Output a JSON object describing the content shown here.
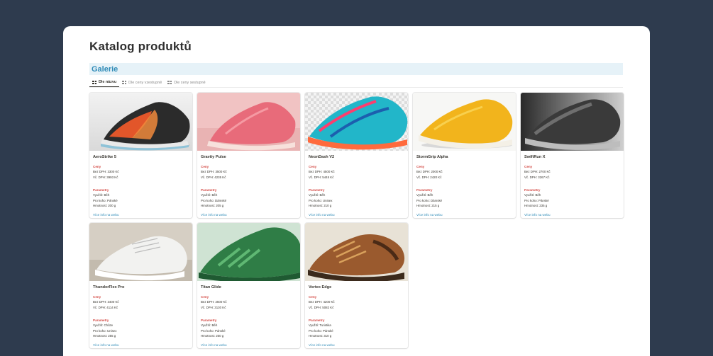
{
  "page": {
    "title": "Katalog produktů"
  },
  "gallery": {
    "title": "Galerie"
  },
  "tabs": [
    {
      "label": "Dle názvu",
      "active": true,
      "icon": "gallery-icon"
    },
    {
      "label": "Dle ceny vzestupně",
      "active": false,
      "icon": "gallery-icon"
    },
    {
      "label": "Dle ceny sestupně",
      "active": false,
      "icon": "gallery-icon"
    }
  ],
  "labels": {
    "prices_heading": "Ceny",
    "params_heading": "Parametry",
    "more_link": "Více info na webu"
  },
  "colors": {
    "background": "#2e3b4e",
    "accent": "#2f8bb7",
    "section_heading": "#d44c47",
    "gallery_bar": "#e6f2f8"
  },
  "products": [
    {
      "name": "AeroStrike 5",
      "bez_dph": "Bez DPH: 3300 Kč",
      "vc_dph": "Vč. DPH: 3993 Kč",
      "vyuziti": "Využití: Běh",
      "pro_koho": "Pro koho: Pánské",
      "hmotnost": "Hmotnost: 200 g",
      "image": "running-shoe-black-orange"
    },
    {
      "name": "Gravity Pulse",
      "bez_dph": "Bez DPH: 3500 Kč",
      "vc_dph": "Vč. DPH: 4235 Kč",
      "vyuziti": "Využití: Běh",
      "pro_koho": "Pro koho: Dámské",
      "hmotnost": "Hmotnost: 205 g",
      "image": "running-shoe-pink"
    },
    {
      "name": "NeonDash V2",
      "bez_dph": "Bez DPH: 4500 Kč",
      "vc_dph": "Vč. DPH: 5445 Kč",
      "vyuziti": "Využití: Běh",
      "pro_koho": "Pro koho: Unisex",
      "hmotnost": "Hmotnost: 210 g",
      "image": "running-shoe-neon"
    },
    {
      "name": "StormGrip Alpha",
      "bez_dph": "Bez DPH: 2000 Kč",
      "vc_dph": "Vč. DPH: 2420 Kč",
      "vyuziti": "Využití: Běh",
      "pro_koho": "Pro koho: Dámské",
      "hmotnost": "Hmotnost: 215 g",
      "image": "running-shoe-yellow"
    },
    {
      "name": "SwiftRun X",
      "bez_dph": "Bez DPH: 2700 Kč",
      "vc_dph": "Vč. DPH: 3267 Kč",
      "vyuziti": "Využití: Běh",
      "pro_koho": "Pro koho: Pánské",
      "hmotnost": "Hmotnost: 235 g",
      "image": "running-shoe-black-grey"
    },
    {
      "name": "ThunderFlex Pro",
      "bez_dph": "Bez DPH: 3400 Kč",
      "vc_dph": "Vč. DPH: 4114 Kč",
      "vyuziti": "Využití: Chůze",
      "pro_koho": "Pro koho: Unisex",
      "hmotnost": "Hmotnost: 255 g",
      "image": "sneaker-white"
    },
    {
      "name": "Titan Glide",
      "bez_dph": "Bez DPH: 2500 Kč",
      "vc_dph": "Vč. DPH: 3130 Kč",
      "vyuziti": "Využití: Běh",
      "pro_koho": "Pro koho: Pánské",
      "hmotnost": "Hmotnost: 250 g",
      "image": "running-shoe-green"
    },
    {
      "name": "Vortex Edge",
      "bez_dph": "Bez DPH: 4200 Kč",
      "vc_dph": "Vč. DPH: 5082 Kč",
      "vyuziti": "Využití: Turistika",
      "pro_koho": "Pro koho: Pánské",
      "hmotnost": "Hmotnost: 310 g",
      "image": "hiking-shoe-brown"
    }
  ]
}
